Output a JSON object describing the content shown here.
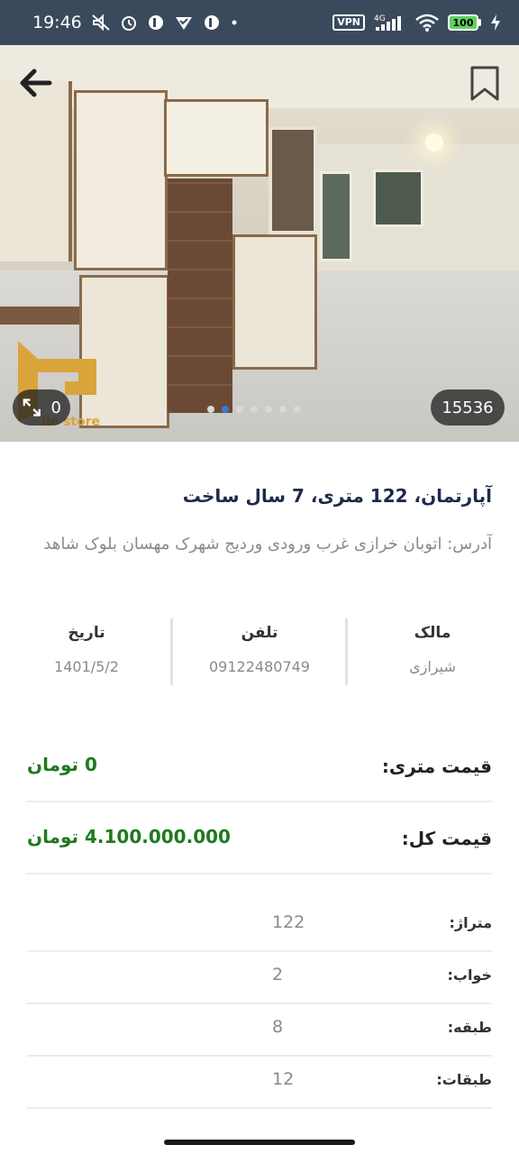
{
  "status_bar": {
    "time": "19:46",
    "vpn": "VPN",
    "network": "4G",
    "battery": "100"
  },
  "gallery": {
    "photo_count": "15536",
    "expand_count": "0",
    "total_dots": 7,
    "active_dot": 1,
    "logo_text": "ile store"
  },
  "listing": {
    "title": "آپارتمان، 122 متری، 7 سال ساخت",
    "address": "آدرس: اتوبان خرازی غرب ورودی وردیج شهرک مهسان بلوک شاهد"
  },
  "info": {
    "owner_label": "مالک",
    "owner_value": "شیرازی",
    "phone_label": "تلفن",
    "phone_value": "09122480749",
    "date_label": "تاریخ",
    "date_value": "1401/5/2"
  },
  "prices": {
    "per_meter_label": "قیمت متری:",
    "per_meter_value": "0 تومان",
    "total_label": "قیمت کل:",
    "total_value": "4.100.000.000 تومان"
  },
  "specs": [
    {
      "label": "متراژ:",
      "value": "122"
    },
    {
      "label": "خواب:",
      "value": "2"
    },
    {
      "label": "طبقه:",
      "value": "8"
    },
    {
      "label": "طبقات:",
      "value": "12"
    }
  ],
  "colors": {
    "status_bar": "#3a4a5c",
    "title": "#1d2a4a",
    "price": "#1e7a1e",
    "active_dot": "#3a7bd5"
  }
}
